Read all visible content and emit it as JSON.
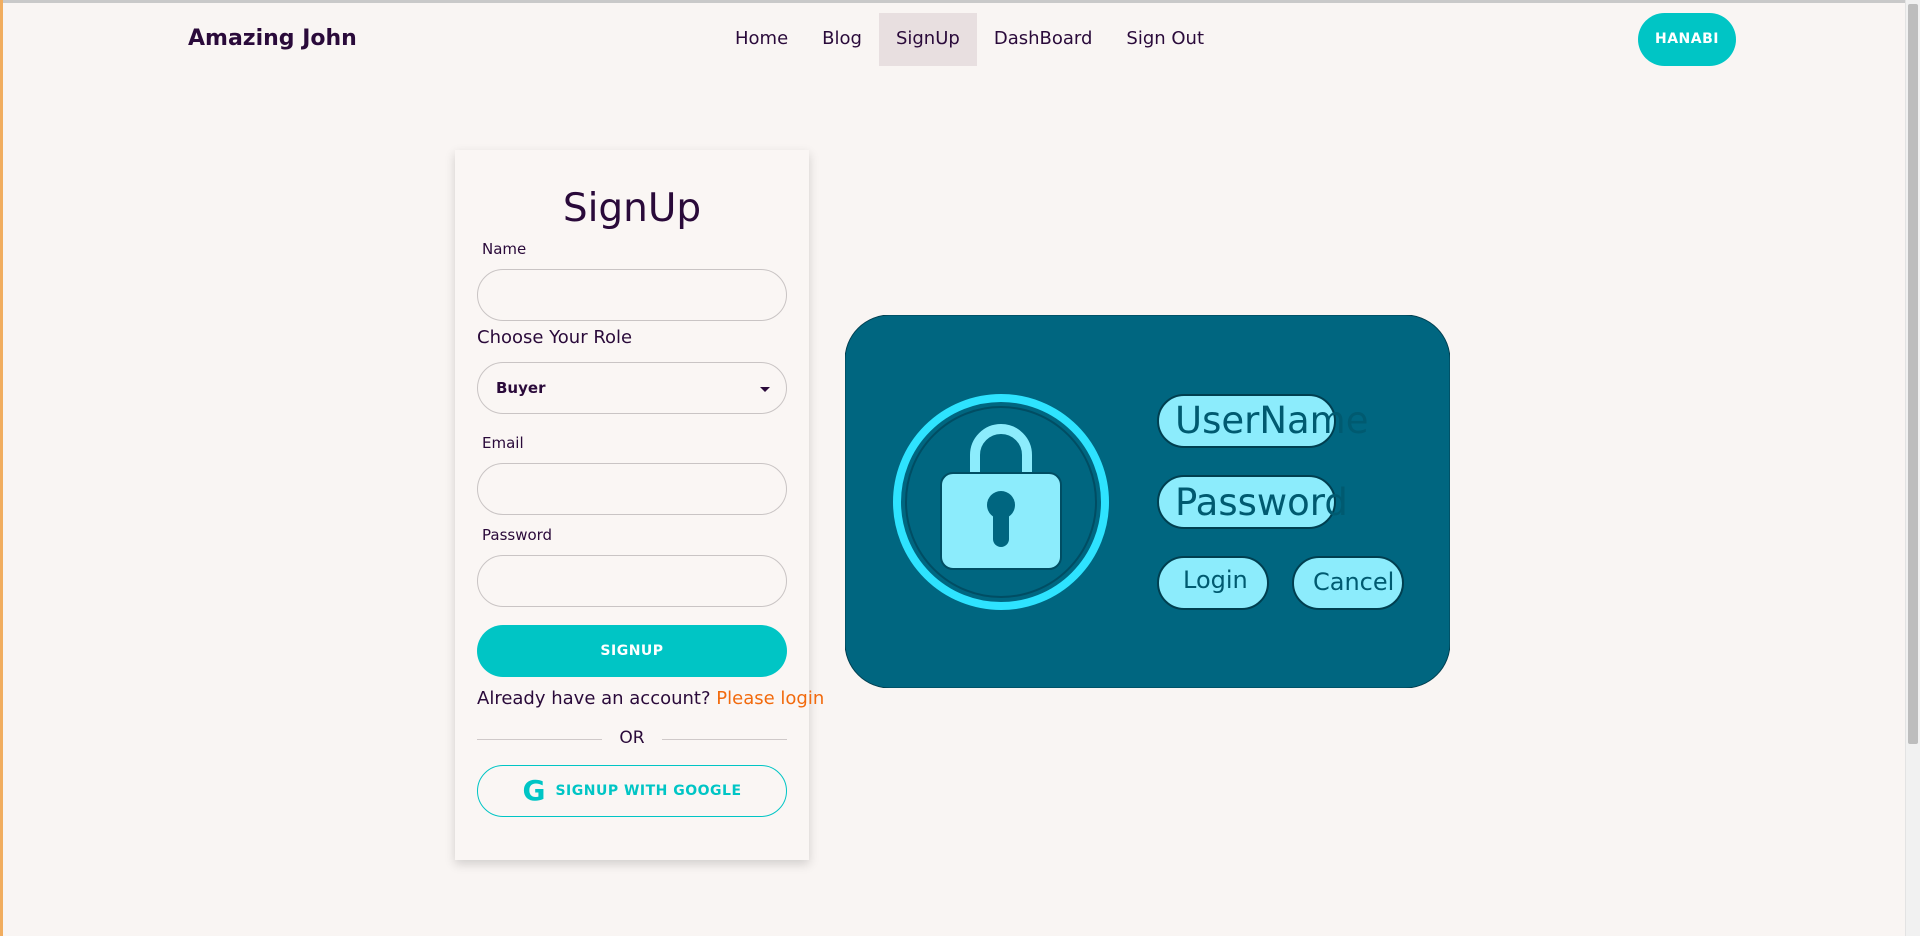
{
  "header": {
    "brand": "Amazing John",
    "nav": [
      "Home",
      "Blog",
      "SignUp",
      "DashBoard",
      "Sign Out"
    ],
    "active_nav": "SignUp",
    "user_button": "HANABI"
  },
  "form": {
    "title": "SignUp",
    "name_label": "Name",
    "name_value": "",
    "role_label": "Choose Your Role",
    "role_selected": "Buyer",
    "email_label": "Email",
    "email_value": "",
    "password_label": "Password",
    "password_value": "",
    "signup_button": "SIGNUP",
    "account_text": "Already have an account?",
    "login_link": "Please login",
    "or_text": "OR",
    "google_button": "SIGNUP WITH GOOGLE",
    "google_icon": "G"
  },
  "illustration": {
    "username_label": "UserName",
    "password_label": "Password",
    "login_label": "Login",
    "cancel_label": "Cancel",
    "icon": "lock-icon"
  },
  "colors": {
    "accent": "#00c5c5",
    "link": "#f26a0d",
    "text": "#2a0a3a",
    "illustration_bg": "#006680",
    "illustration_light": "#8cecfc"
  }
}
